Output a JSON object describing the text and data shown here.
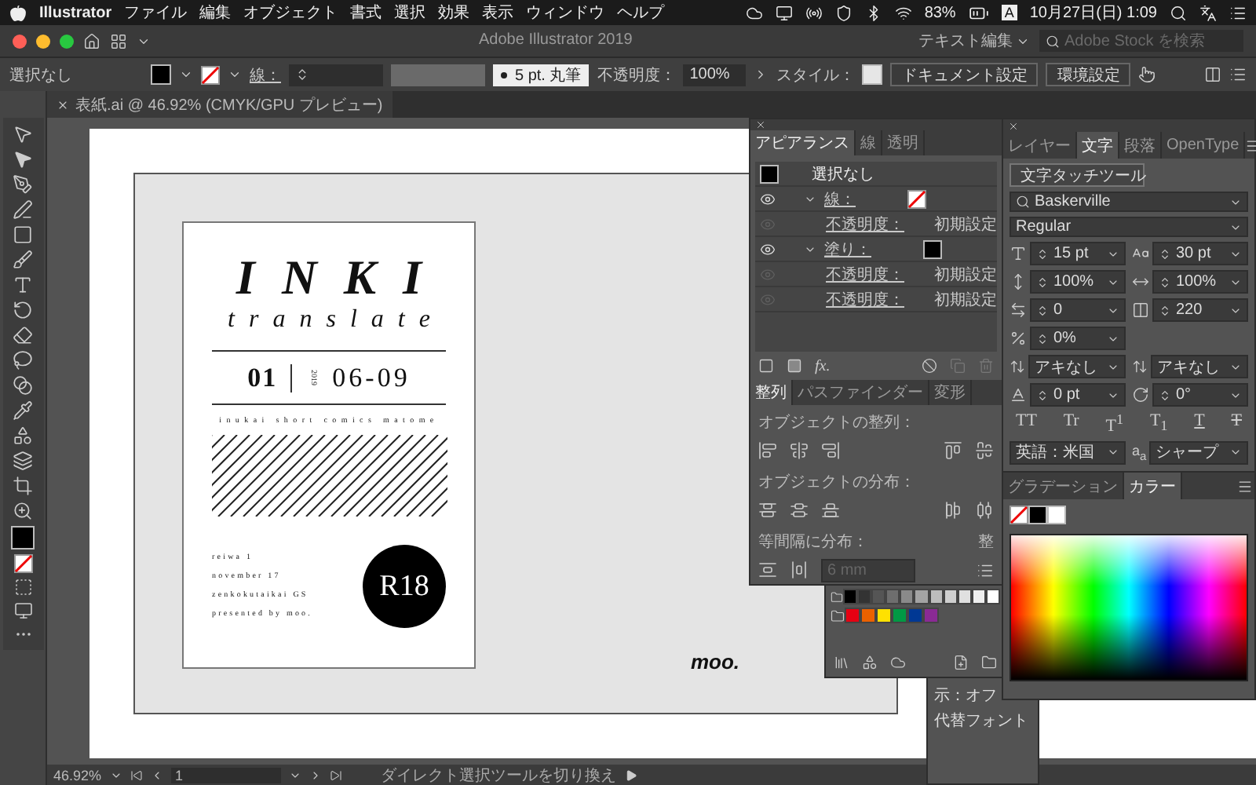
{
  "menubar": {
    "app": "Illustrator",
    "menus": [
      "ファイル",
      "編集",
      "オブジェクト",
      "書式",
      "選択",
      "効果",
      "表示",
      "ウィンドウ",
      "ヘルプ"
    ],
    "battery": "83%",
    "input_mode": "A",
    "clock": "10月27日(日) 1:09"
  },
  "window": {
    "title": "Adobe Illustrator 2019",
    "workspace": "テキスト編集",
    "search": {
      "placeholder": "Adobe Stock を検索"
    }
  },
  "control_bar": {
    "selection": "選択なし",
    "stroke_label": "線：",
    "brush": "5 pt. 丸筆",
    "opacity_label": "不透明度：",
    "opacity": "100%",
    "style_label": "スタイル：",
    "buttons": [
      "ドキュメント設定",
      "環境設定"
    ]
  },
  "document_tab": {
    "title": "表紙.ai @ 46.92% (CMYK/GPU プレビュー)"
  },
  "artwork": {
    "title": "INKI",
    "subtitle": "translate",
    "issue": "01",
    "year": "2019",
    "date": "06-09",
    "tagline": "inukai short comics matome",
    "details": [
      "reiwa 1",
      "november 17",
      "zenkokutaikai GS",
      "presented by moo."
    ],
    "badge": "R18",
    "logo": "moo."
  },
  "appearance_panel": {
    "tabs": [
      {
        "label": "アピアランス",
        "selected": true
      },
      {
        "label": "線",
        "selected": false
      },
      {
        "label": "透明",
        "selected": false
      }
    ],
    "heading": "選択なし",
    "rows": [
      {
        "kind": "attribute",
        "label": "線：",
        "swatch": {
          "kind": "none"
        },
        "visible": true
      },
      {
        "kind": "opacity",
        "label": "不透明度：",
        "value": "初期設定",
        "visible": false
      },
      {
        "kind": "attribute",
        "label": "塗り：",
        "swatch": {
          "kind": "black"
        },
        "visible": true
      },
      {
        "kind": "opacity",
        "label": "不透明度：",
        "value": "初期設定",
        "visible": false
      },
      {
        "kind": "object_opacity",
        "label": "不透明度：",
        "value": "初期設定",
        "visible": false
      }
    ],
    "fx_button": "fx."
  },
  "align_panel": {
    "tabs": [
      {
        "label": "整列",
        "selected": true
      },
      {
        "label": "パスファインダー",
        "selected": false
      },
      {
        "label": "変形",
        "selected": false
      }
    ],
    "sections": [
      "オブジェクトの整列：",
      "オブジェクトの分布：",
      "等間隔に分布："
    ],
    "spacing": {
      "value": "6 mm",
      "disabled": true
    },
    "side_label": "整"
  },
  "character_panel": {
    "tabs": [
      {
        "label": "レイヤー",
        "selected": false
      },
      {
        "label": "文字",
        "selected": true
      },
      {
        "label": "段落",
        "selected": false
      },
      {
        "label": "OpenType",
        "selected": false
      }
    ],
    "touch_tool": "文字タッチツール",
    "font": "Baskerville",
    "style": "Regular",
    "field_rows": [
      [
        {
          "kind": "spinner",
          "value": "15 pt"
        },
        {
          "kind": "spinner",
          "value": "30 pt"
        }
      ],
      [
        {
          "kind": "spinner",
          "value": "100%"
        },
        {
          "kind": "spinner",
          "value": "100%"
        }
      ],
      [
        {
          "kind": "spinner",
          "value": "0"
        },
        {
          "kind": "spinner",
          "value": "220"
        }
      ],
      [
        {
          "kind": "spinner",
          "value": "0%"
        }
      ],
      [
        {
          "kind": "select",
          "value": "アキなし"
        },
        {
          "kind": "select",
          "value": "アキなし"
        }
      ],
      [
        {
          "kind": "spinner",
          "value": "0 pt"
        },
        {
          "kind": "spinner",
          "value": "0°"
        }
      ]
    ],
    "type_styles": [
      "TT",
      "Tr",
      "T$^{1}$",
      "T$_{1}$",
      "T",
      "T"
    ],
    "language": "英語：米国",
    "antialias_label": "a$_{a}$",
    "antialias": "シャープ"
  },
  "color_panel": {
    "tabs": [
      {
        "label": "グラデーション",
        "selected": false
      },
      {
        "label": "カラー",
        "selected": true
      }
    ]
  },
  "swatches_panel": {
    "rows": [
      [
        {
          "color": "#000000"
        },
        {
          "color": "#333333"
        },
        {
          "color": "#555555"
        },
        {
          "color": "#6e6e6e"
        },
        {
          "color": "#8a8a8a"
        },
        {
          "color": "#a3a3a3"
        },
        {
          "color": "#bcbcbc"
        },
        {
          "color": "#cfcfcf"
        },
        {
          "color": "#e0e0e0"
        },
        {
          "color": "#efefef"
        },
        {
          "color": "#ffffff"
        }
      ],
      [
        {
          "color": "#e60012"
        },
        {
          "color": "#eb6100"
        },
        {
          "color": "#ffe100"
        },
        {
          "color": "#009944"
        },
        {
          "color": "#003894"
        },
        {
          "color": "#8a2a94"
        }
      ]
    ]
  },
  "glyph_panel": {
    "lines": [
      "示：オフ",
      "代替フォント"
    ]
  },
  "status_bar": {
    "zoom": "46.92%",
    "page": "1",
    "message": "ダイレクト選択ツールを切り換え"
  }
}
